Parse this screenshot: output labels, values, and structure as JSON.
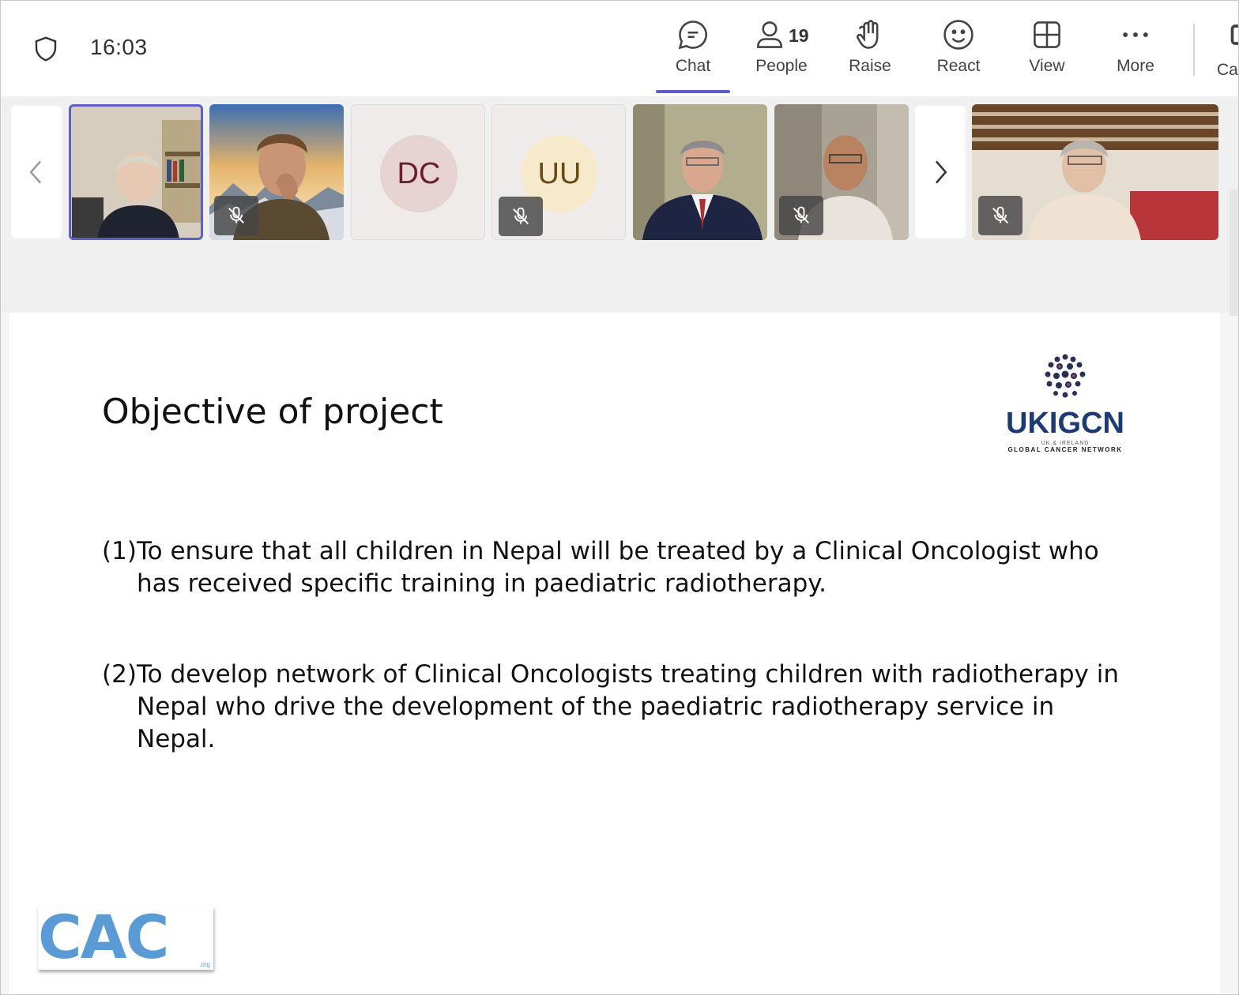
{
  "toolbar": {
    "time": "16:03",
    "chat_label": "Chat",
    "people_label": "People",
    "people_count": "19",
    "raise_label": "Raise",
    "react_label": "React",
    "view_label": "View",
    "more_label": "More",
    "cut_label": "Ca"
  },
  "participants": [
    {
      "type": "video",
      "muted": false,
      "selected": true
    },
    {
      "type": "video",
      "muted": true
    },
    {
      "type": "avatar",
      "initials": "DC",
      "color": "#e8d3d3",
      "text_color": "#6b1f2a",
      "muted": false
    },
    {
      "type": "avatar",
      "initials": "UU",
      "color": "#f7e9cc",
      "text_color": "#6b4a12",
      "muted": true
    },
    {
      "type": "video",
      "muted": false
    },
    {
      "type": "video",
      "muted": true
    },
    {
      "type": "video",
      "muted": true
    }
  ],
  "slide": {
    "title": "Objective of project",
    "objectives": [
      {
        "num": "(1)",
        "text": "To ensure that all children in Nepal will be treated by a Clinical Oncologist who has received specific training in paediatric radiotherapy."
      },
      {
        "num": "(2)",
        "text": "To develop network of Clinical Oncologists treating children with radiotherapy in Nepal who drive the development of the paediatric radiotherapy service in Nepal."
      }
    ],
    "logo_ukigcn": {
      "name": "UKIGCN",
      "line1": "UK & IRELAND",
      "line2": "GLOBAL CANCER NETWORK"
    },
    "logo_cac": {
      "name": "CAC",
      "suffix": ".org"
    }
  },
  "colors": {
    "accent": "#5b5fc7",
    "ukigcn_blue": "#1d3a73",
    "cac_blue": "#5b9bd5"
  }
}
